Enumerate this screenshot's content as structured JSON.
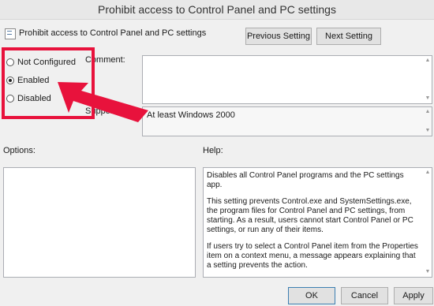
{
  "window": {
    "title": "Prohibit access to Control Panel and PC settings"
  },
  "header": {
    "policy_name": "Prohibit access to Control Panel and PC settings",
    "prev_button": "Previous Setting",
    "next_button": "Next Setting"
  },
  "state": {
    "options": [
      {
        "label": "Not Configured",
        "selected": false
      },
      {
        "label": "Enabled",
        "selected": true
      },
      {
        "label": "Disabled",
        "selected": false
      }
    ]
  },
  "comment": {
    "label": "Comment:",
    "value": ""
  },
  "supported": {
    "label": "Supported on:",
    "value": "At least Windows 2000"
  },
  "options_pane": {
    "label": "Options:"
  },
  "help": {
    "label": "Help:",
    "paragraphs": [
      "Disables all Control Panel programs and the PC settings app.",
      "This setting prevents Control.exe and SystemSettings.exe, the program files for Control Panel and PC settings, from starting. As a result, users cannot start Control Panel or PC settings, or run any of their items.",
      "If users try to select a Control Panel item from the Properties item on a context menu, a message appears explaining that a setting prevents the action."
    ]
  },
  "footer": {
    "ok": "OK",
    "cancel": "Cancel",
    "apply": "Apply"
  },
  "colors": {
    "annotation": "#e8123c"
  }
}
